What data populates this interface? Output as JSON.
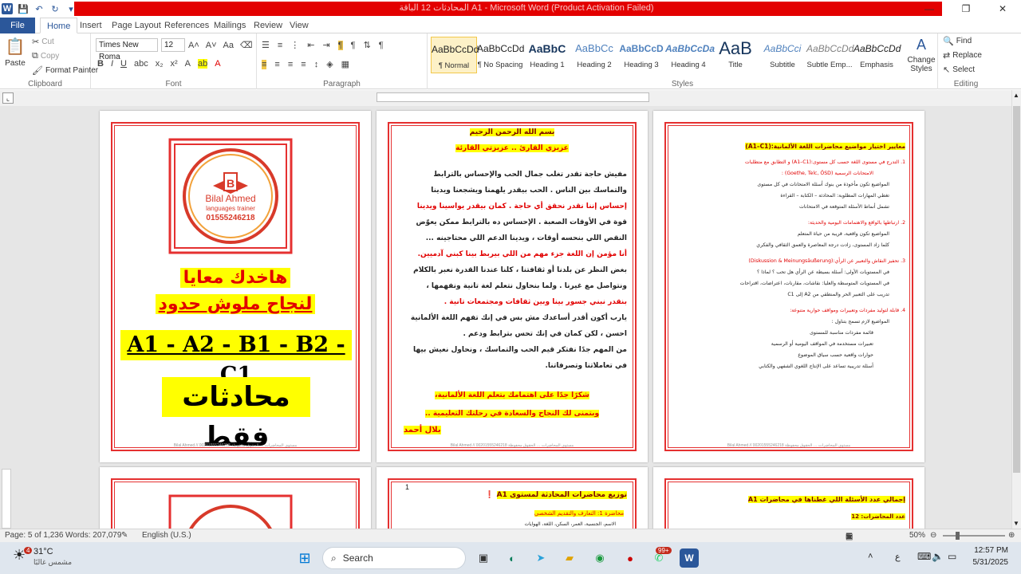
{
  "window": {
    "title": "المحادثات 12 الباقة A1 - Microsoft Word (Product Activation Failed)",
    "controls": [
      "—",
      "❐",
      "✕"
    ]
  },
  "tabs": [
    "File",
    "Home",
    "Insert",
    "Page Layout",
    "References",
    "Mailings",
    "Review",
    "View"
  ],
  "ribbon": {
    "clipboard": {
      "paste": "Paste",
      "cut": "Cut",
      "copy": "Copy",
      "format_painter": "Format Painter",
      "label": "Clipboard"
    },
    "font": {
      "name": "Times New Roma",
      "size": "12",
      "label": "Font"
    },
    "paragraph": {
      "label": "Paragraph"
    },
    "styles": {
      "label": "Styles",
      "items": [
        {
          "preview": "AaBbCcDd",
          "name": "¶ Normal"
        },
        {
          "preview": "AaBbCcDd",
          "name": "¶ No Spacing"
        },
        {
          "preview": "AaBbC",
          "name": "Heading 1"
        },
        {
          "preview": "AaBbCc",
          "name": "Heading 2"
        },
        {
          "preview": "AaBbCcD",
          "name": "Heading 3"
        },
        {
          "preview": "AaBbCcDa",
          "name": "Heading 4"
        },
        {
          "preview": "AaB",
          "name": "Title"
        },
        {
          "preview": "AaBbCci",
          "name": "Subtitle"
        },
        {
          "preview": "AaBbCcDd",
          "name": "Subtle Emp..."
        },
        {
          "preview": "AaBbCcDd",
          "name": "Emphasis"
        }
      ],
      "change_styles": "Change Styles"
    },
    "editing": {
      "find": "Find",
      "replace": "Replace",
      "select": "Select",
      "label": "Editing"
    }
  },
  "page1": {
    "logo_name": "Bilal Ahmed",
    "logo_sub": "languages trainer",
    "logo_phone": "01555246218",
    "line1": "هاخدك معايا",
    "line2": "لنجاح ملوش حدود",
    "levels": "A1 - A2 - B1 - B2 - C1",
    "conversations": "محادثات فقط"
  },
  "page2": {
    "basmala": "بسم الله الرحمن الرحيم",
    "greeting": "عزيزي القارئ .. عزيزتي القارئة",
    "lines": [
      "مفيش حاجة تقدر تغلب جمال الحب والإحساس بالترابط",
      "والتماسك بين الناس . الحب بيقدر يلهمنا ويشجعنا ويدينا",
      "إحساس إننا نقدر نحقق أي حاجة . كمان بيقدر يواسينا ويدينا",
      "قوة في الأوقات الصعبة . الإحساس ده بالترابط ممكن يعوّض",
      "النقص اللي بنحسه أوقات ، ويدينا الدعم اللي محتاجينه ...",
      "أنا مؤمن إن اللغة جزء مهم من اللي بيربط بينا كبني آدميين.",
      "بغض النظر عن بلدنا أو ثقافتنا ، كلنا عندنا القدرة نعبر بالكلام",
      "ونتواصل مع غيرنا . ولما بنحاول نتعلم لغة تانية ونفهمها ،",
      "بنقدر نبني جسور بينا وبين ثقافات ومجتمعات تانية .",
      "يارب أكون أقدر أساعدك مش بس في إنك تفهم اللغة الألمانية",
      "احسن ، لكن كمان في إنك تحس بترابط ودعم .",
      "من المهم جدًا نفتكر قيم الحب والتماسك ، ونحاول نعيش بيها",
      "في تعاملاتنا وتصرفاتنا."
    ],
    "thanks": "شكرًا جدًا على اهتمامك بتعلم اللغة الألمانية،",
    "wish": "وبتمنى لك النجاح والسعادة في رحلتك التعليمية ..",
    "signature": "بلال أحمد"
  },
  "page3": {
    "heading": "معايير اختيار مواضيع محاضرات اللغة الألمانية:(A1–C1)",
    "items": [
      "1. التدرج في مستوى اللغة حسب كل مستوى:(A1–C1) و التطابق مع متطلبات",
      "الامتحانات الرسمية (Goethe, Telc, ÖSD) :",
      "المواضيع تكون مأخوذة من بنوك أسئلة الامتحانات في كل مستوى",
      "تغطي المهارات المطلوبة: المحادثة – الكتابة – القراءة",
      "تشمل أنماط الأسئلة المتوقعة في الامتحانات",
      "2. ارتباطها بالواقع والاهتمامات اليومية والحديثة:",
      "المواضيع تكون واقعية، قريبة من حياة المتعلم",
      "كلما زاد المستوى، زادت درجة المعاصرة والعمق الثقافي والفكري",
      "3. تحفيز النقاش والتعبير عن الرأي:(Diskussion & Meinungsäußerung)",
      "في المستويات الأولى: أسئلة بسيطة عن الرأي هل تحب ؟ لماذا ؟",
      "في المستويات المتوسطة والعليا: نقاشات، مقارنات، اعتراضات، اقتراحات",
      "تدريب على التعبير الحر والمنطقي من A2 إلى C1",
      "4. قابلة لتوليد مفردات وتعبيرات ومواقف حوارية متنوعة:",
      "المواضيع لازم تسمح بتناول :",
      "قائمة مفردات مناسبة للمستوى",
      "تعبيرات مستخدمة في المواقف اليومية أو الرسمية",
      "حوارات واقعية حسب سياق الموضوع",
      "أسئلة تدريبية تساعد على الإنتاج اللغوي الشفهي والكتابي"
    ]
  },
  "page4": {
    "title": "توزيع محاضرات المحادثة لمستوى A1",
    "lecture": "محاضرة 1: التعارف والتقديم الشخصي",
    "sub": "الاسم، الجنسية، العمر، السكن، اللغة، الهوايات",
    "num": "1"
  },
  "page5": {
    "title": "إجمالي عدد الأسئلة اللي غطناها في محاضرات A1",
    "sub": "عدد المحاضرات: 12"
  },
  "footer_text": "Bilal Ahmed // 00201555246218  مستوى المحاضرات … الحقوق محفوظة",
  "statusbar": {
    "page": "Page: 5 of 1,236",
    "words": "Words: 207,079",
    "language": "English (U.S.)",
    "zoom": "50%"
  },
  "taskbar": {
    "weather_temp": "31°C",
    "weather_desc": "مشمس غالبًا",
    "search": "Search",
    "time": "12:57 PM",
    "date": "5/31/2025",
    "lang": "ع",
    "badge_weather": "4",
    "badge_whatsapp": "99+"
  }
}
